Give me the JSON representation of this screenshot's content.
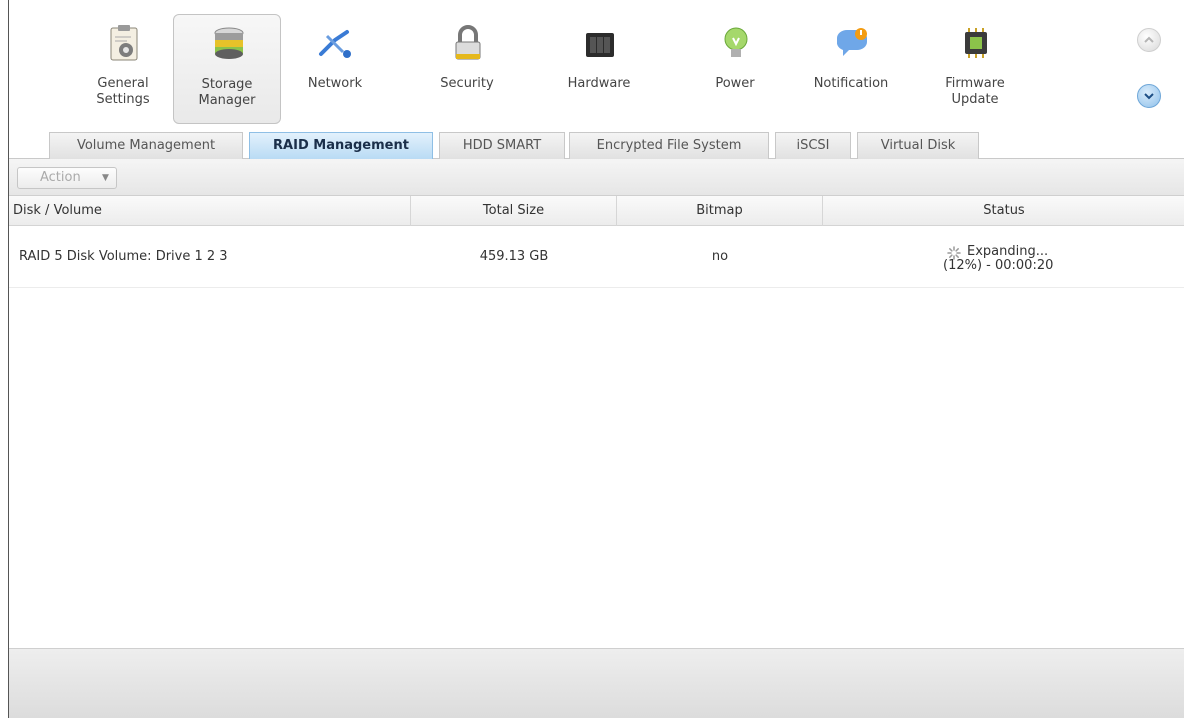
{
  "apps": [
    {
      "label": "General\nSettings",
      "icon": "general-settings-icon"
    },
    {
      "label": "Storage\nManager",
      "icon": "storage-manager-icon",
      "selected": true
    },
    {
      "label": "Network",
      "icon": "network-icon"
    },
    {
      "label": "Security",
      "icon": "security-lock-icon"
    },
    {
      "label": "Hardware",
      "icon": "hardware-icon"
    },
    {
      "label": "Power",
      "icon": "power-bulb-icon"
    },
    {
      "label": "Notification",
      "icon": "notification-icon"
    },
    {
      "label": "Firmware\nUpdate",
      "icon": "firmware-update-icon"
    }
  ],
  "tabs": [
    {
      "label": "Volume Management"
    },
    {
      "label": "RAID Management",
      "active": true
    },
    {
      "label": "HDD SMART"
    },
    {
      "label": "Encrypted File System"
    },
    {
      "label": "iSCSI"
    },
    {
      "label": "Virtual Disk"
    }
  ],
  "toolbar": {
    "action_label": "Action"
  },
  "table": {
    "headers": [
      "Disk / Volume",
      "Total Size",
      "Bitmap",
      "Status"
    ],
    "rows": [
      {
        "volume": "RAID 5 Disk Volume: Drive 1 2 3",
        "total_size": "459.13 GB",
        "bitmap": "no",
        "status_line1": "Expanding...",
        "status_line2": "(12%) - 00:00:20"
      }
    ]
  },
  "colors": {
    "active_tab": "#b9dbf4",
    "accent": "#6fa7d8"
  }
}
